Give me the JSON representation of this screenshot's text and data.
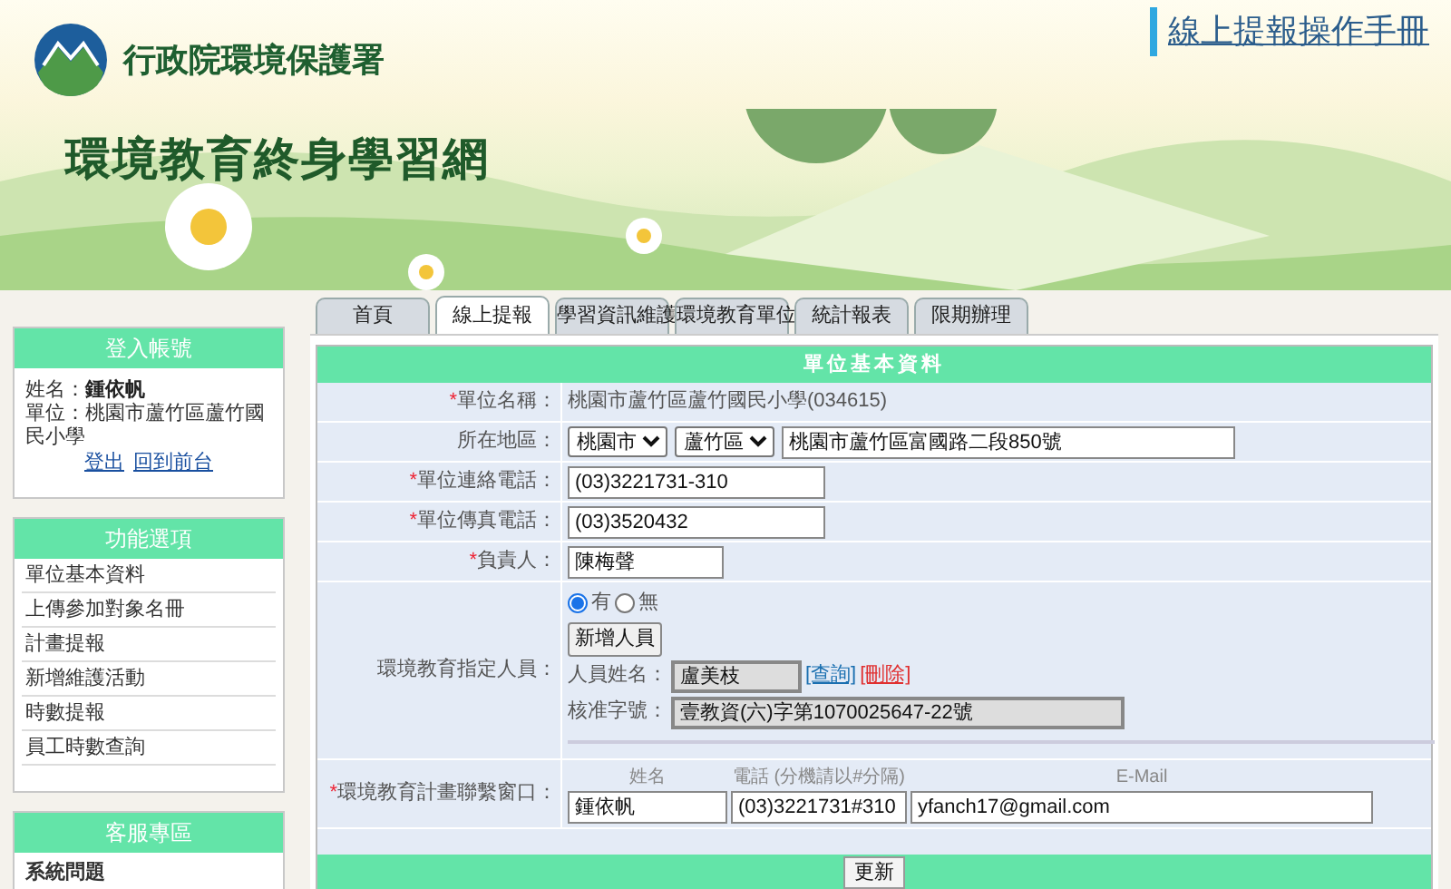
{
  "header": {
    "agency": "行政院環境保護署",
    "site_title": "環境教育終身學習網",
    "manual_link": "線上提報操作手冊"
  },
  "sidebar": {
    "login": {
      "title": "登入帳號",
      "name_label": "姓名：",
      "name": "鍾依帆",
      "unit_label": "單位：",
      "unit": "桃園市蘆竹區蘆竹國民小學",
      "links": [
        "登出",
        "回到前台"
      ]
    },
    "functions": {
      "title": "功能選項",
      "items": [
        {
          "label": "單位基本資料"
        },
        {
          "label": "上傳參加對象名冊"
        },
        {
          "label": "計畫提報"
        },
        {
          "label": "新增維護活動"
        },
        {
          "label": "時數提報"
        },
        {
          "label": "員工時數查詢"
        }
      ]
    },
    "service": {
      "title": "客服專區",
      "heading": "系統問題"
    }
  },
  "tabs": [
    {
      "label": "首頁",
      "selected": false
    },
    {
      "label": "線上提報",
      "selected": true
    },
    {
      "label": "學習資訊維護",
      "selected": false
    },
    {
      "label": "環境教育單位",
      "selected": false
    },
    {
      "label": "統計報表",
      "selected": false
    },
    {
      "label": "限期辦理",
      "selected": false
    }
  ],
  "form": {
    "title": "單位基本資料",
    "rows": [
      {
        "kind": "text",
        "label": "單位名稱：",
        "required": true,
        "value": "桃園市蘆竹區蘆竹國民小學(034615)"
      },
      {
        "kind": "address",
        "label": "所在地區：",
        "required": false,
        "city": "桃園市",
        "district": "蘆竹區",
        "address": "桃園市蘆竹區富國路二段850號"
      },
      {
        "kind": "input",
        "label": "單位連絡電話：",
        "required": true,
        "value": "(03)3221731-310"
      },
      {
        "kind": "input",
        "label": "單位傳真電話：",
        "required": true,
        "value": "(03)3520432"
      },
      {
        "kind": "short",
        "label": "負責人：",
        "required": true,
        "value": "陳梅聲"
      },
      {
        "kind": "designee",
        "label": "環境教育指定人員：",
        "required": false,
        "radios": [
          {
            "label": "有",
            "selected": true
          },
          {
            "label": "無",
            "selected": false
          }
        ],
        "add_button": "新增人員",
        "name_label": "人員姓名：",
        "name_value": "盧美枝",
        "query_link": "[查詢]",
        "delete_link": "[刪除]",
        "approval_label": "核准字號：",
        "approval_value": "壹教資(六)字第1070025647-22號"
      },
      {
        "kind": "contact",
        "label": "環境教育計畫聯繫窗口：",
        "required": true,
        "headers": [
          "姓名",
          "電話 (分機請以#分隔)",
          "E-Mail"
        ],
        "values": [
          "鍾依帆",
          "(03)3221731#310",
          "yfanch17@gmail.com"
        ]
      }
    ],
    "required_mark": "*",
    "submit": "更新"
  }
}
